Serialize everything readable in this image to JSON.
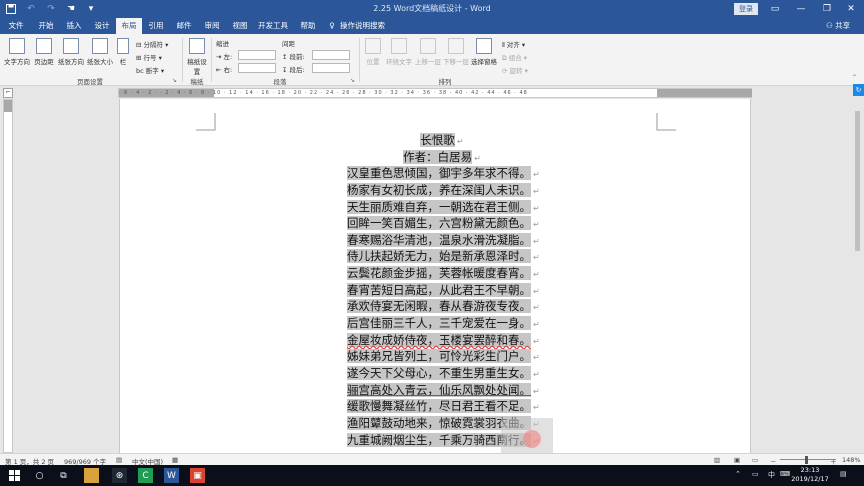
{
  "window": {
    "title": "2.25 Word文档稿纸设计 - Word",
    "login_label": "登录",
    "quick_access": [
      "save-icon",
      "undo-icon",
      "redo-icon",
      "touch-mode-icon",
      "customize-icon"
    ]
  },
  "menu": {
    "tabs": [
      "文件",
      "开始",
      "插入",
      "设计",
      "布局",
      "引用",
      "邮件",
      "审阅",
      "视图",
      "开发工具",
      "帮助"
    ],
    "tell_me": "操作说明搜索",
    "share": "共享"
  },
  "ribbon": {
    "page_setup": {
      "buttons": [
        "文字方向",
        "页边距",
        "纸张方向",
        "纸张大小",
        "栏"
      ],
      "small": [
        "分隔符",
        "行号",
        "断字"
      ],
      "label": "页面设置"
    },
    "manuscript": {
      "button": "稿纸设置",
      "label": "稿纸"
    },
    "paragraph": {
      "indent_label": "缩进",
      "spacing_label": "间距",
      "left": "左:",
      "right": "右:",
      "before": "段前:",
      "after": "段后:",
      "label": "段落"
    },
    "arrange": {
      "buttons": [
        "位置",
        "环绕文字",
        "上移一层",
        "下移一层",
        "选择窗格"
      ],
      "small": [
        "对齐",
        "组合",
        "旋转"
      ],
      "label": "排列"
    }
  },
  "document": {
    "title": "长恨歌",
    "author": "作者：白居易",
    "lines": [
      "汉皇重色思倾国，御宇多年求不得。",
      "杨家有女初长成，养在深闺人未识。",
      "天生丽质难自弃，一朝选在君王侧。",
      "回眸一笑百媚生，六宫粉黛无颜色。",
      "春寒赐浴华清池，温泉水滑洗凝脂。",
      "侍儿扶起娇无力，始是新承恩泽时。",
      "云鬓花颜金步摇，芙蓉帐暖度春宵。",
      "春宵苦短日高起，从此君王不早朝。",
      "承欢侍宴无闲暇，春从春游夜专夜。",
      "后宫佳丽三千人，三千宠爱在一身。",
      "金屋妆成娇侍夜，玉楼宴罢醉和春。",
      "姊妹弟兄皆列土，可怜光彩生门户。",
      "遂今天下父母心，不重生男重生女。",
      "骊宫高处入青云，仙乐风飘处处闻。",
      "缓歌慢舞凝丝竹，尽日君王看不足。",
      "渔阳鼙鼓动地来，惊破霓裳羽衣曲。",
      "九重城阙烟尘生，千乘万骑西南行。"
    ],
    "paragraph_mark": "↵"
  },
  "status": {
    "page": "第 1 页，共 2 页",
    "words": "969/969 个字",
    "language": "中文(中国)",
    "zoom": "148%",
    "zoom_minus": "－",
    "zoom_plus": "＋"
  },
  "taskbar": {
    "ime": "中",
    "time": "23:13",
    "date": "2019/12/17"
  },
  "colors": {
    "word_blue": "#2b579a",
    "selection": "#c6c6c6",
    "taskbar": "#0a0f1a"
  }
}
